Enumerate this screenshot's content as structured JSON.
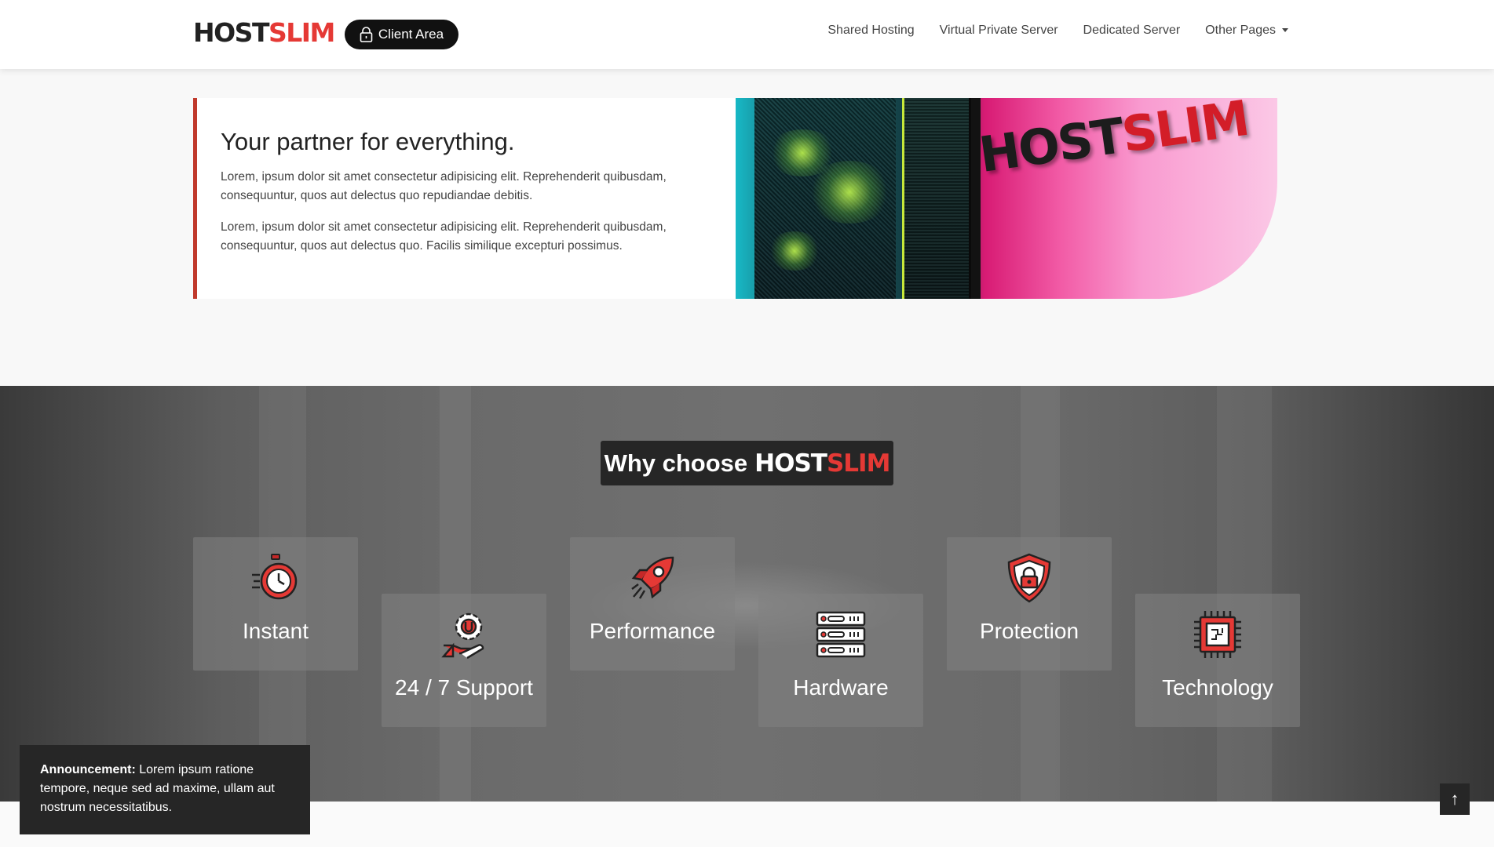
{
  "navbar": {
    "brand_part1": "HOST",
    "brand_part2": "SLIM",
    "client_area_label": "Client Area",
    "links": [
      "Shared Hosting",
      "Virtual Private Server",
      "Dedicated Server",
      "Other Pages"
    ]
  },
  "hero": {
    "title": "Your partner for everything.",
    "paragraph1": "Lorem, ipsum dolor sit amet consectetur adipisicing elit. Reprehenderit quibusdam, consequuntur, quos aut delectus quo repudiandae debitis.",
    "paragraph2": "Lorem, ipsum dolor sit amet consectetur adipisicing elit. Reprehenderit quibusdam, consequuntur, quos aut delectus quo. Facilis similique excepturi possimus.",
    "sign_part1": "HOST",
    "sign_part2": "SLIM"
  },
  "why": {
    "heading_prefix": "Why choose",
    "heading_brand1": "HOST",
    "heading_brand2": "SLIM",
    "features": [
      {
        "label": "Instant",
        "icon": "stopwatch-icon"
      },
      {
        "label": "24 / 7 Support",
        "icon": "support-gear-hand-icon"
      },
      {
        "label": "Performance",
        "icon": "rocket-icon"
      },
      {
        "label": "Hardware",
        "icon": "server-rack-icon"
      },
      {
        "label": "Protection",
        "icon": "shield-lock-icon"
      },
      {
        "label": "Technology",
        "icon": "cpu-chip-icon"
      }
    ]
  },
  "announcement": {
    "label": "Announcement:",
    "text": "Lorem ipsum ratione tempore, neque sed ad maxime, ullam aut nostrum necessitatibus."
  },
  "back_to_top": {
    "symbol": "↑"
  },
  "colors": {
    "accent_red": "#e53935",
    "dark": "#262626"
  }
}
